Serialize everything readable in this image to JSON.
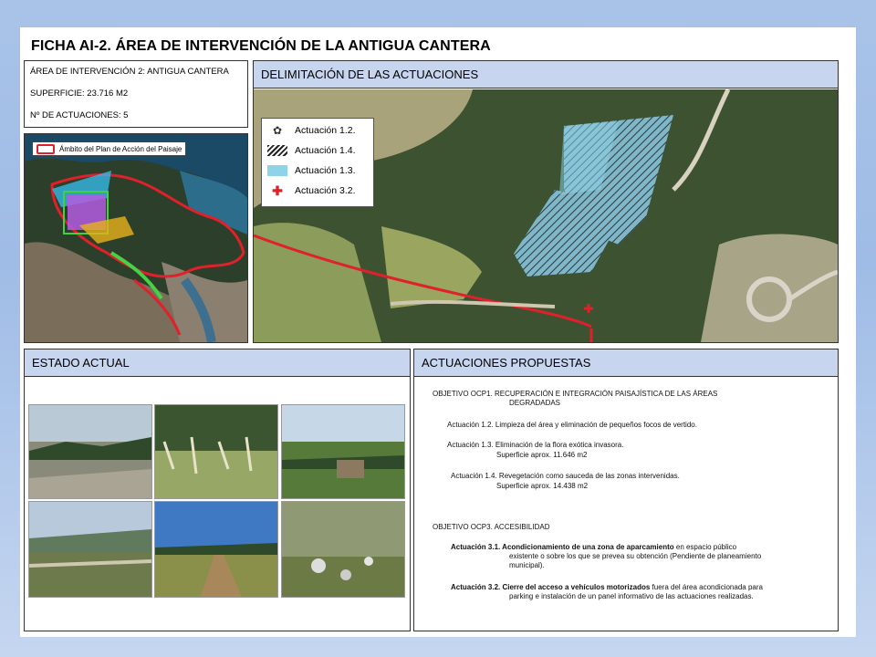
{
  "title": "FICHA AI-2. ÁREA DE INTERVENCIÓN DE LA ANTIGUA CANTERA",
  "info": {
    "area": "ÁREA DE INTERVENCIÓN 2:    ANTIGUA CANTERA",
    "superficie": "SUPERFICIE: 23.716 M2",
    "actuaciones": "Nº DE ACTUACIONES: 5"
  },
  "small_map": {
    "legend_label": "Ámbito del Plan de Acción del Paisaje"
  },
  "delimitacion": {
    "header": "DELIMITACIÓN DE LAS ACTUACIONES",
    "legend": [
      {
        "label": "Actuación 1.2.",
        "icon": "flower-icon"
      },
      {
        "label": "Actuación 1.4.",
        "icon": "hatch-icon"
      },
      {
        "label": "Actuación 1.3.",
        "icon": "light-blue-swatch"
      },
      {
        "label": "Actuación 3.2.",
        "icon": "red-cross-icon"
      }
    ]
  },
  "estado": {
    "header": "ESTADO ACTUAL"
  },
  "propuestas": {
    "header": "ACTUACIONES PROPUESTAS",
    "obj1_a": "OBJETIVO OCP1. RECUPERACIÓN E INTEGRACIÓN PAISAJÍSTICA DE LAS ÁREAS",
    "obj1_b": "DEGRADADAS",
    "a12": "Actuación 1.2. Limpieza del área y eliminación de pequeños focos de vertido.",
    "a13": "Actuación 1.3. Eliminación de la flora exótica invasora.",
    "a13_sup": "Superficie aprox. 11.646 m2",
    "a14": "Actuación 1.4. Revegetación como sauceda de las zonas intervenidas.",
    "a14_sup": "Superficie aprox. 14.438 m2",
    "obj3": "OBJETIVO OCP3. ACCESIBILIDAD",
    "a31_bold": "Actuación 3.1. Acondicionamiento de una zona de aparcamiento",
    "a31_rest": " en espacio público",
    "a31_l2": "existente o sobre los que se prevea su obtención (Pendiente de planeamiento",
    "a31_l3": "municipal).",
    "a32_bold": "Actuación 3.2. Cierre del acceso a vehículos motorizados",
    "a32_rest": " fuera del área acondicionada para",
    "a32_l2": "parking e instalación de un panel informativo de las actuaciones realizadas."
  },
  "colors": {
    "header_bg": "#c7d6ee",
    "accent_red": "#e0202a",
    "action_blue": "#8fd3e8"
  }
}
